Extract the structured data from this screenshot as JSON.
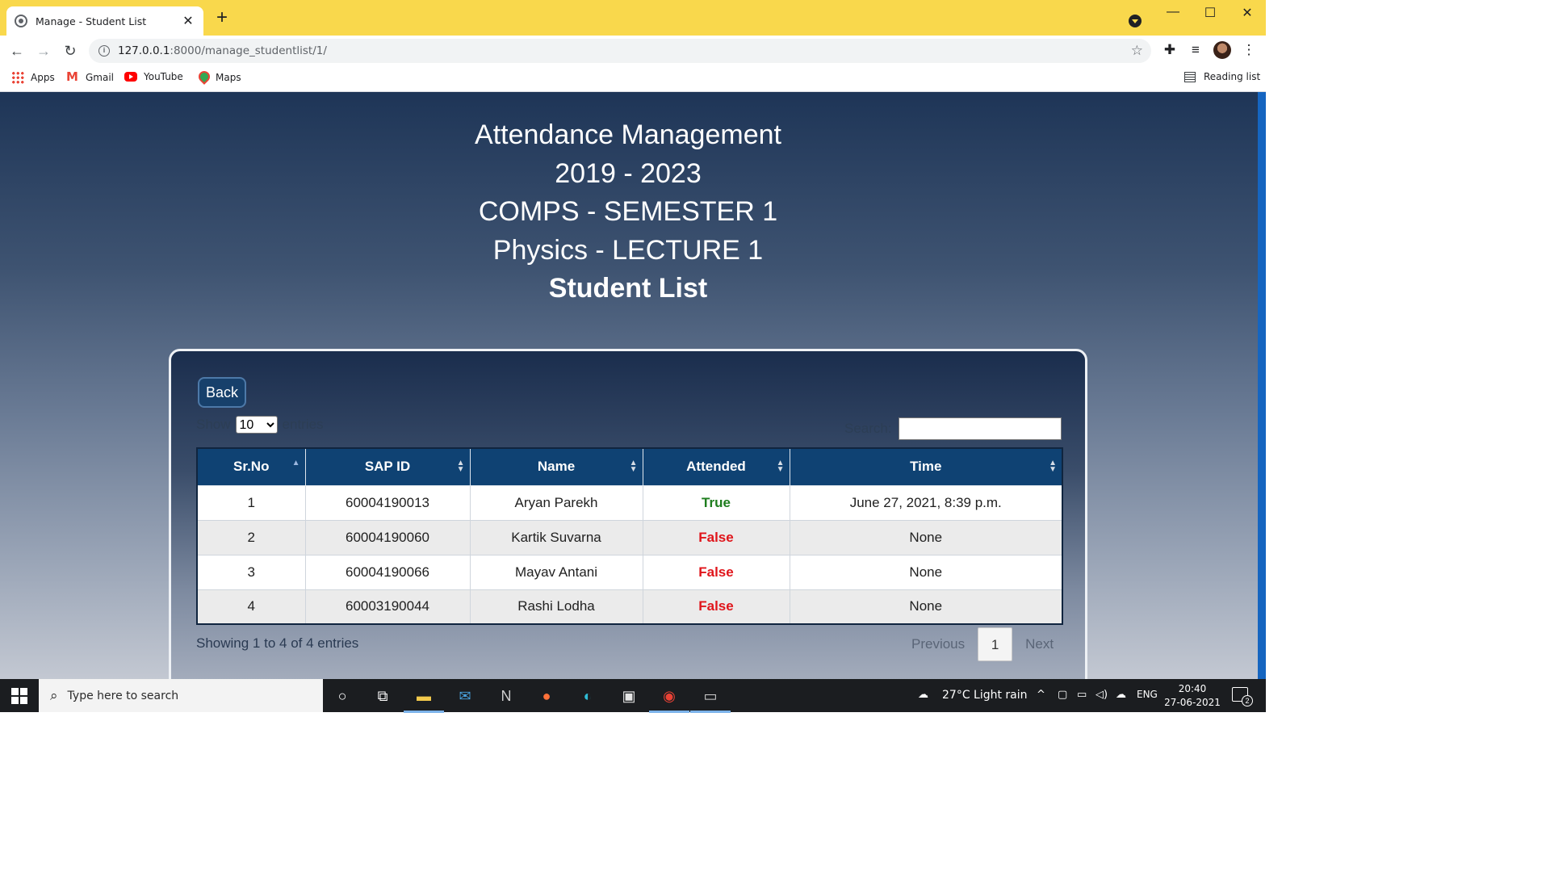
{
  "browser": {
    "tab_title": "Manage - Student List",
    "tab_close": "✕",
    "new_tab": "+",
    "url": "127.0.0.1:8000/manage_studentlist/1/",
    "url_host": "127.0.0.1",
    "url_rest": ":8000/manage_studentlist/1/",
    "bookmarks": [
      {
        "label": "Apps",
        "icon": "apps-grid-icon"
      },
      {
        "label": "Gmail",
        "icon": "gmail-icon"
      },
      {
        "label": "YouTube",
        "icon": "youtube-icon"
      },
      {
        "label": "Maps",
        "icon": "maps-pin-icon"
      }
    ],
    "reading_list": "Reading list",
    "accent_color": "#f9d84c"
  },
  "page": {
    "heading_lines": [
      "Attendance Management",
      "2019 - 2023",
      "COMPS - SEMESTER 1",
      "Physics - LECTURE 1",
      "Student List"
    ],
    "back_label": "Back",
    "show_label": "Show",
    "entries_label": "entries",
    "page_length": "10",
    "search_label": "Search:",
    "search_value": "",
    "table": {
      "columns": [
        "Sr.No",
        "SAP ID",
        "Name",
        "Attended",
        "Time"
      ],
      "sorted_column": "Sr.No",
      "rows": [
        {
          "sr": "1",
          "sap": "60004190013",
          "name": "Aryan Parekh",
          "attended": "True",
          "time": "June 27, 2021, 8:39 p.m."
        },
        {
          "sr": "2",
          "sap": "60004190060",
          "name": "Kartik Suvarna",
          "attended": "False",
          "time": "None"
        },
        {
          "sr": "3",
          "sap": "60004190066",
          "name": "Mayav Antani",
          "attended": "False",
          "time": "None"
        },
        {
          "sr": "4",
          "sap": "60003190044",
          "name": "Rashi Lodha",
          "attended": "False",
          "time": "None"
        }
      ]
    },
    "info": "Showing 1 to 4 of 4 entries",
    "pagination": {
      "previous": "Previous",
      "current": "1",
      "next": "Next"
    },
    "colors": {
      "true": "#1e7d1e",
      "false": "#e0151b",
      "header": "#0f4273"
    }
  },
  "taskbar": {
    "search_placeholder": "Type here to search",
    "weather": "27°C  Light rain",
    "language": "ENG",
    "time": "20:40",
    "date": "27-06-2021",
    "notification_count": "2"
  }
}
